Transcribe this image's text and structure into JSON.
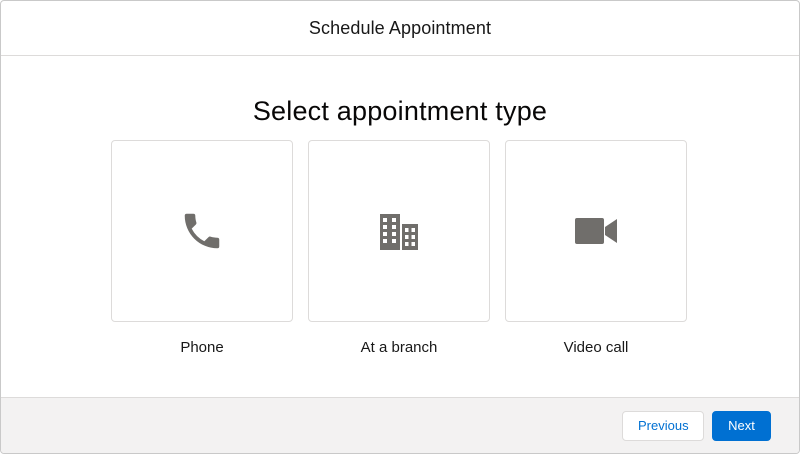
{
  "header": {
    "title": "Schedule Appointment"
  },
  "main": {
    "heading": "Select appointment type",
    "options": [
      {
        "label": "Phone",
        "icon": "phone-icon"
      },
      {
        "label": "At a branch",
        "icon": "building-icon"
      },
      {
        "label": "Video call",
        "icon": "video-camera-icon"
      }
    ]
  },
  "footer": {
    "previous_label": "Previous",
    "next_label": "Next"
  },
  "colors": {
    "icon": "#706e6b",
    "brand": "#0070d2",
    "footer_bg": "#f3f2f2",
    "border": "#dddbda"
  }
}
